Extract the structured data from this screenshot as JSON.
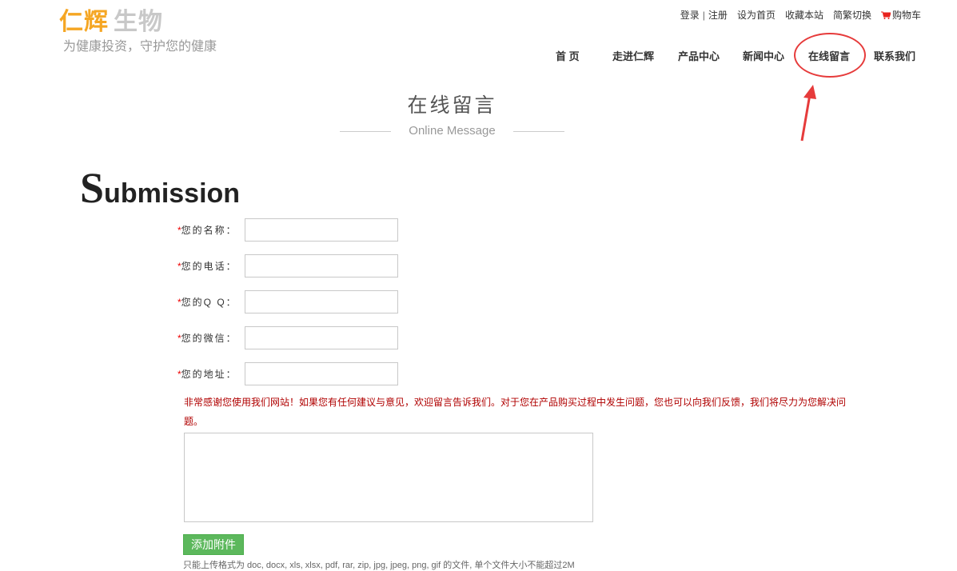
{
  "logo": {
    "part1": "仁辉",
    "part2": "生物",
    "slogan": "为健康投资，守护您的健康"
  },
  "toplinks": {
    "login": "登录",
    "register": "注册",
    "homepage": "设为首页",
    "favorite": "收藏本站",
    "lang": "简繁切换",
    "cart": "购物车"
  },
  "nav": {
    "home": "首 页",
    "about": "走进仁辉",
    "products": "产品中心",
    "news": "新闻中心",
    "message": "在线留言",
    "contact": "联系我们"
  },
  "page": {
    "title_cn": "在线留言",
    "title_en": "Online Message",
    "submission_first": "S",
    "submission_rest": "ubmission"
  },
  "form": {
    "required_mark": "*",
    "name_label": "您的名称：",
    "phone_label": "您的电话：",
    "qq_label": "您的Q Q：",
    "wechat_label": "您的微信：",
    "address_label": "您的地址：",
    "notice": "非常感谢您使用我们网站！如果您有任何建议与意见，欢迎留言告诉我们。对于您在产品购买过程中发生问题，您也可以向我们反馈，我们将尽力为您解决问题。",
    "attach_button": "添加附件",
    "attach_note": "只能上传格式为 doc, docx, xls, xlsx, pdf, rar, zip, jpg, jpeg, png, gif 的文件, 单个文件大小不能超过2M"
  },
  "colors": {
    "logo_accent": "#f5a623",
    "required": "#e00000",
    "notice": "#b00000",
    "button": "#5cb85c",
    "highlight": "#e63b3b"
  }
}
